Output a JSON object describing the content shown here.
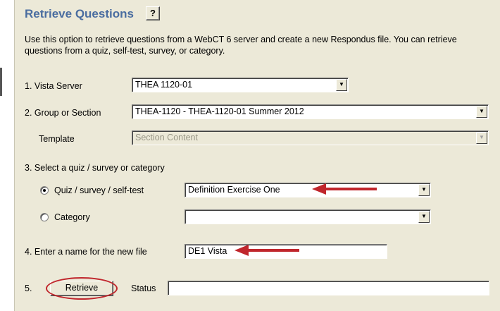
{
  "title": "Retrieve Questions",
  "help_label": "?",
  "description": "Use this option to retrieve questions from a WebCT 6 server and create a new Respondus file.  You can retrieve questions from a quiz, self-test, survey, or category.",
  "vista_server": {
    "label": "1. Vista Server",
    "value": "THEA 1120-01"
  },
  "group_section": {
    "label": "2. Group or Section",
    "value": "THEA-1120 - THEA-1120-01 Summer 2012"
  },
  "template": {
    "label": "Template",
    "value": "Section Content"
  },
  "select_step": {
    "label": "3. Select a quiz / survey or category"
  },
  "quiz_option": {
    "label": "Quiz / survey / self-test",
    "selected": true,
    "value": "Definition Exercise One"
  },
  "category_option": {
    "label": "Category",
    "selected": false,
    "value": ""
  },
  "file_name": {
    "label": "4. Enter a name for the new file",
    "value": "DE1 Vista"
  },
  "retrieve_step": {
    "label": "5.",
    "button_label": "Retrieve",
    "status_label": "Status",
    "status_value": ""
  },
  "colors": {
    "annotation": "#c0262c",
    "title": "#4a6da0",
    "panel": "#ece9d8"
  },
  "icons": {
    "dropdown": "triangle-down",
    "annotation_arrow": "red-arrow-left"
  }
}
